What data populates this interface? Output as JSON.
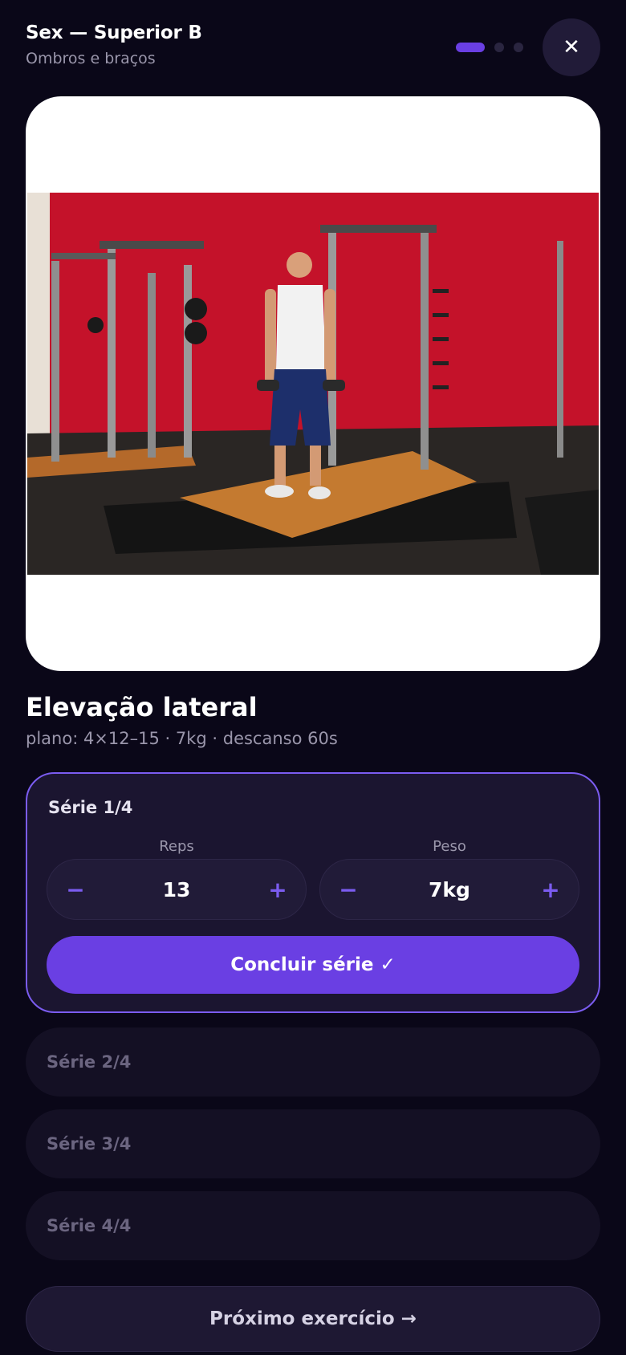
{
  "header": {
    "title": "Sex — Superior B",
    "subtitle": "Ombros e braços",
    "progress_steps": 3,
    "progress_current": 1,
    "close_label": "✕"
  },
  "exercise": {
    "name": "Elevação lateral",
    "plan": "plano: 4×12–15 · 7kg · descanso 60s"
  },
  "active_set": {
    "label": "Série 1/4",
    "reps_label": "Reps",
    "reps_value": "13",
    "weight_label": "Peso",
    "weight_value": "7kg",
    "minus_symbol": "−",
    "plus_symbol": "+",
    "complete_label": "Concluir série ✓"
  },
  "pending_sets": [
    {
      "label": "Série 2/4"
    },
    {
      "label": "Série 3/4"
    },
    {
      "label": "Série 4/4"
    }
  ],
  "next_label": "Próximo exercício →",
  "colors": {
    "background": "#0a0718",
    "accent": "#6a3fe3",
    "accent_border": "#7b5cf0",
    "muted_text": "#9a96ab"
  }
}
